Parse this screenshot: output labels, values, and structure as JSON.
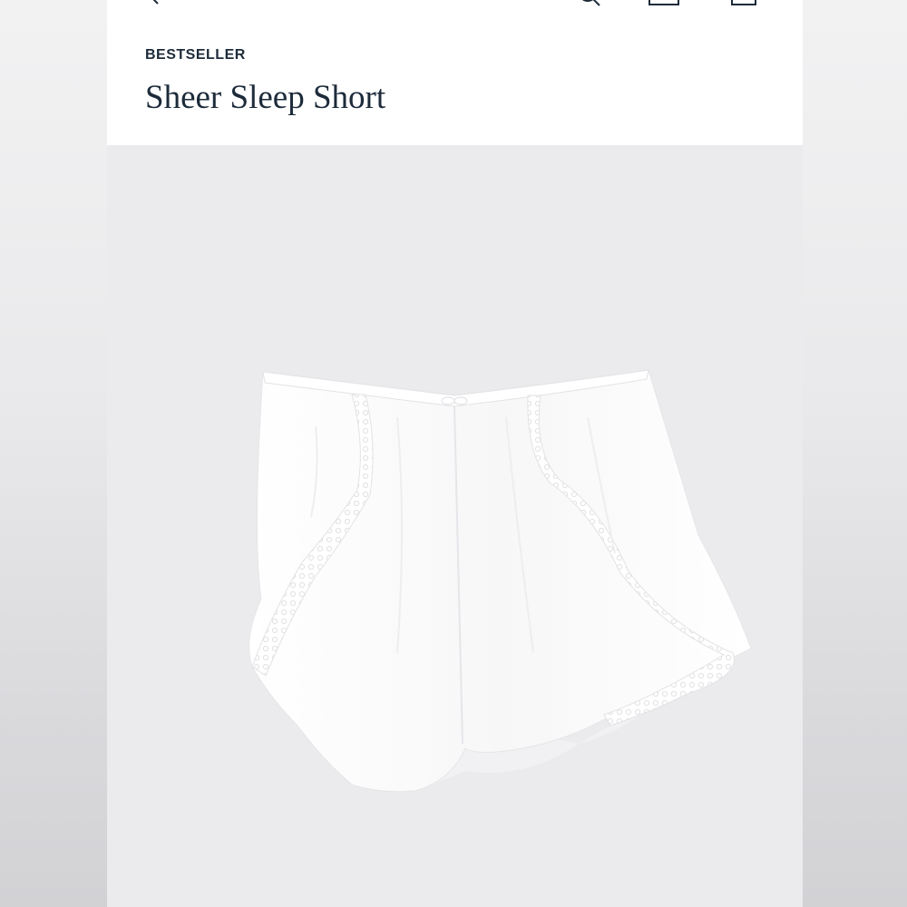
{
  "header": {
    "badge": "BESTSELLER",
    "product_title": "Sheer Sleep Short"
  },
  "icons": {
    "back": "back-chevron-icon",
    "search": "search-icon",
    "account": "account-icon",
    "bag": "shopping-bag-icon"
  },
  "product_image": {
    "subject": "white-sleep-shorts"
  },
  "colors": {
    "text": "#1d2b3a",
    "image_bg": "#ebeaec",
    "garment": "#ffffff"
  }
}
